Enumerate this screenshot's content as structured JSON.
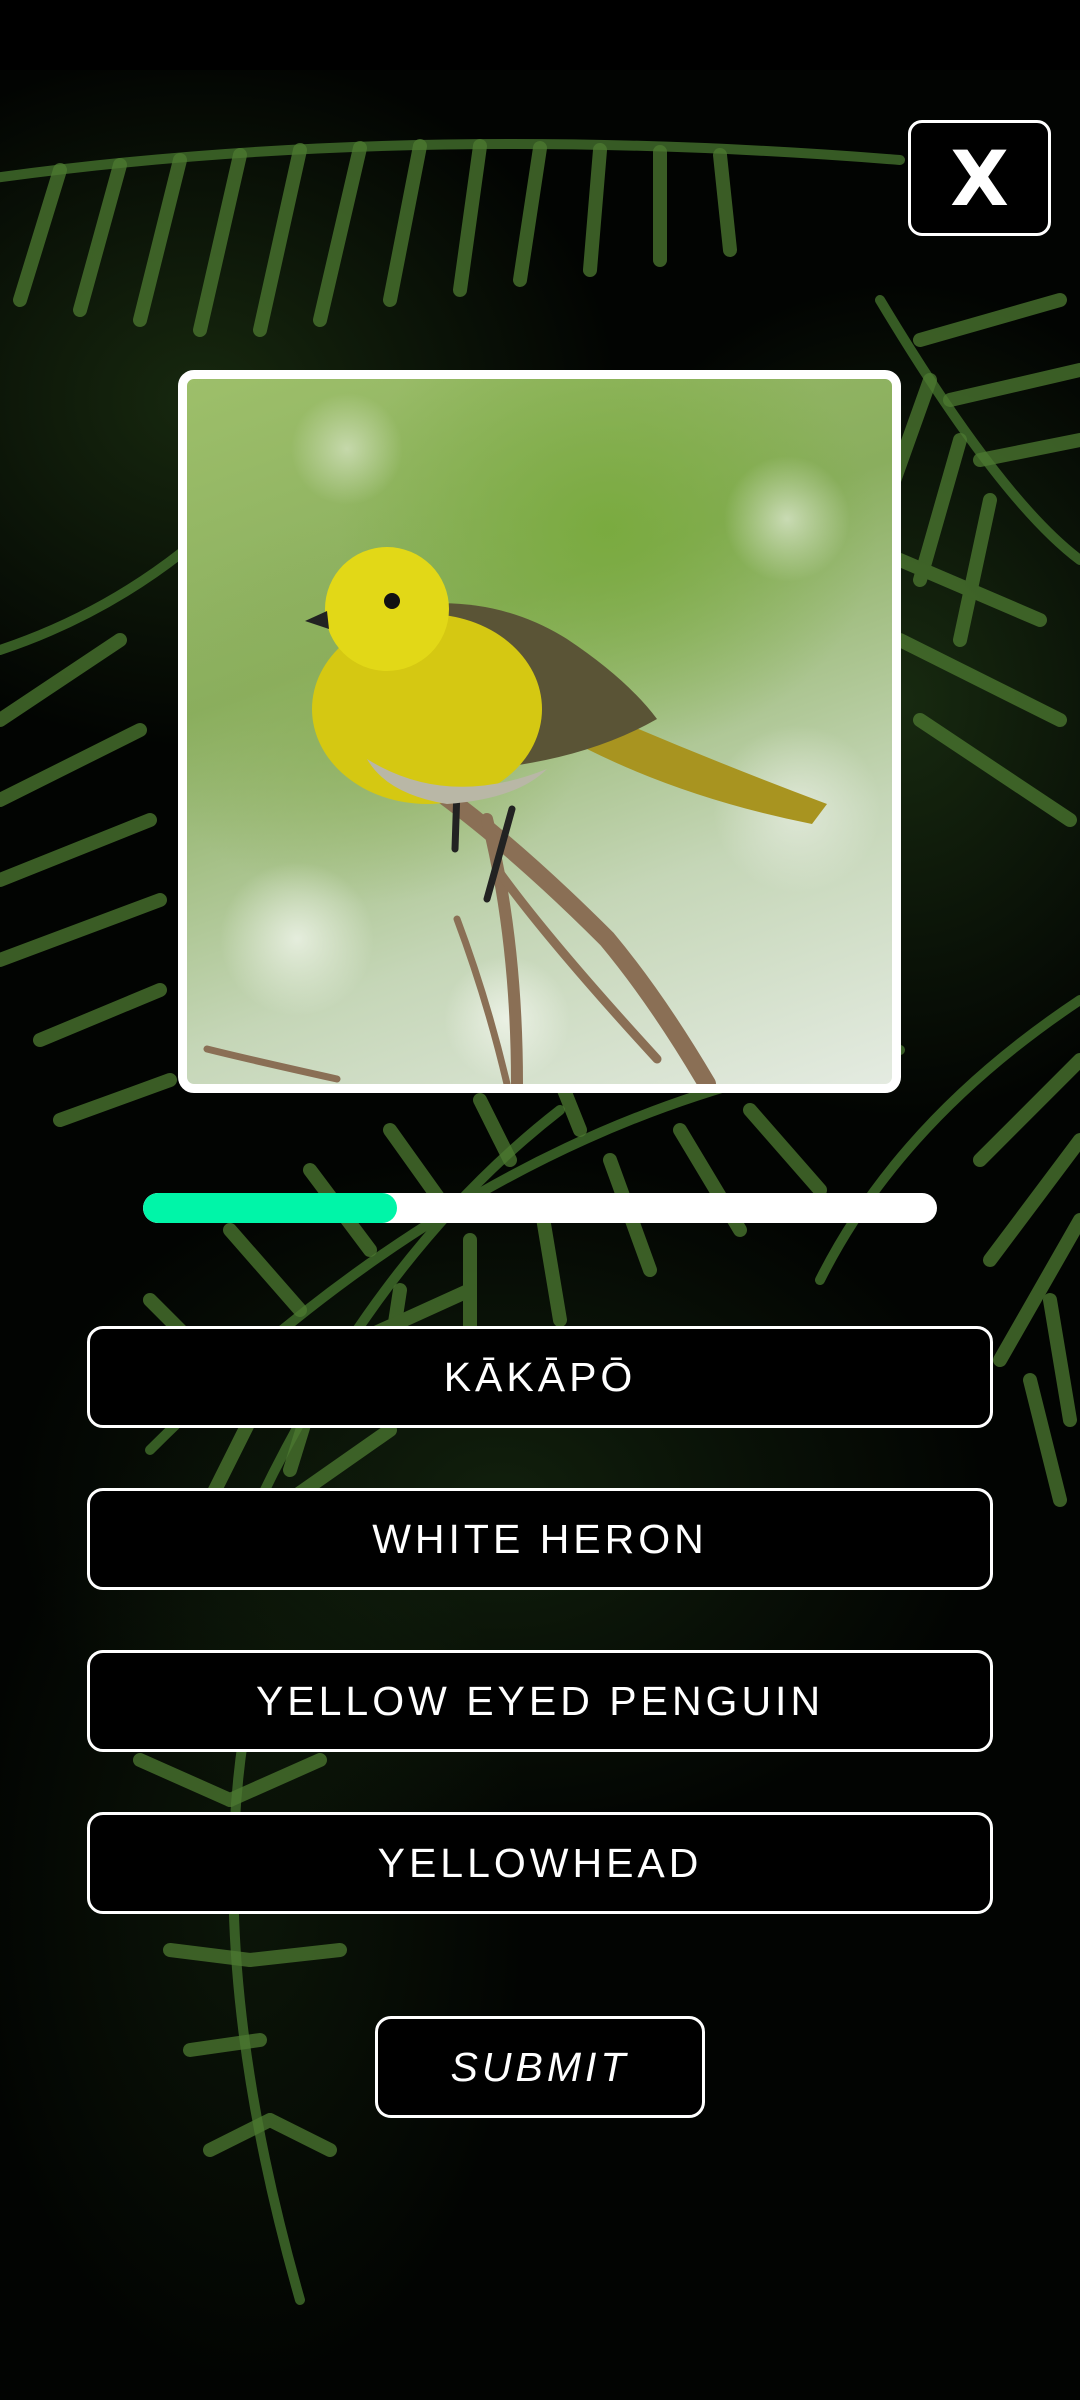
{
  "quiz": {
    "close_label": "X",
    "image_subject": "yellowhead bird perched on branch",
    "progress_fraction": 0.32,
    "progress_color": "#00f5a8",
    "options": [
      {
        "label": "KĀKĀPŌ"
      },
      {
        "label": "WHITE HERON"
      },
      {
        "label": "YELLOW EYED PENGUIN"
      },
      {
        "label": "YELLOWHEAD"
      }
    ],
    "submit_label": "SUBMIT"
  },
  "icons": {
    "close": "close-icon"
  }
}
